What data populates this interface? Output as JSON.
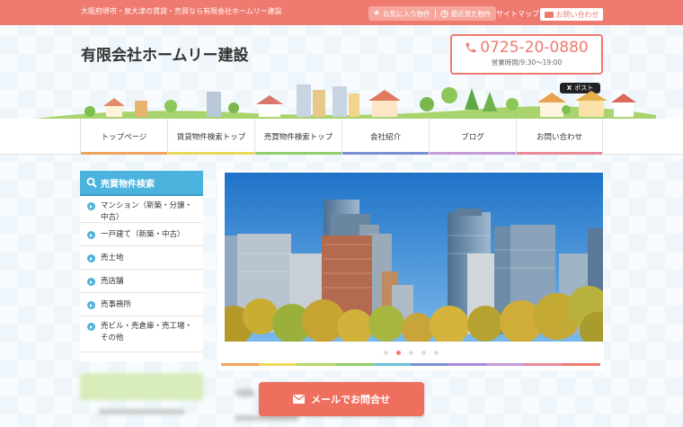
{
  "topbar": {
    "tagline": "大阪府堺市・泉大津の賃貸・売買なら有限会社ホームリー建設",
    "favorites_label": "お気に入り物件",
    "recent_label": "最近見た物件",
    "sitemap_label": "サイトマップ",
    "contact_label": "お問い合わせ"
  },
  "header": {
    "site_title": "有限会社ホームリー建設",
    "phone": "0725-20-0880",
    "hours": "営業時間/9:30〜19:00",
    "post_label": "ポスト"
  },
  "nav": {
    "items": [
      {
        "label": "トップページ",
        "color": "#f0a35e"
      },
      {
        "label": "賃貸物件検索トップ",
        "color": "#e9d95a"
      },
      {
        "label": "売買物件検索トップ",
        "color": "#8fcf6a"
      },
      {
        "label": "会社紹介",
        "color": "#7b8fd3"
      },
      {
        "label": "ブログ",
        "color": "#c69ad6"
      },
      {
        "label": "お問い合わせ",
        "color": "#e98a9b"
      }
    ]
  },
  "sidebar": {
    "title": "売買物件検索",
    "items": [
      {
        "label": "マンション（新築・分譲・中古）"
      },
      {
        "label": "一戸建て（新築・中古）"
      },
      {
        "label": "売土地"
      },
      {
        "label": "売店舗"
      },
      {
        "label": "売事務所"
      },
      {
        "label": "売ビル・売倉庫・売工場・その他"
      }
    ]
  },
  "slider": {
    "active_index": 1,
    "count": 5
  },
  "cta": {
    "mail_label": "メールでお問合せ"
  },
  "colors": {
    "accent": "#ef7a6f",
    "sidebar": "#4bb3dd",
    "rainbow": [
      "#f0a35e",
      "#e9d95a",
      "#b5d86a",
      "#8fcf6a",
      "#6cc3d8",
      "#7b8fd3",
      "#a58bd9",
      "#c69ad6",
      "#e98a9b",
      "#ef7a6f"
    ]
  }
}
